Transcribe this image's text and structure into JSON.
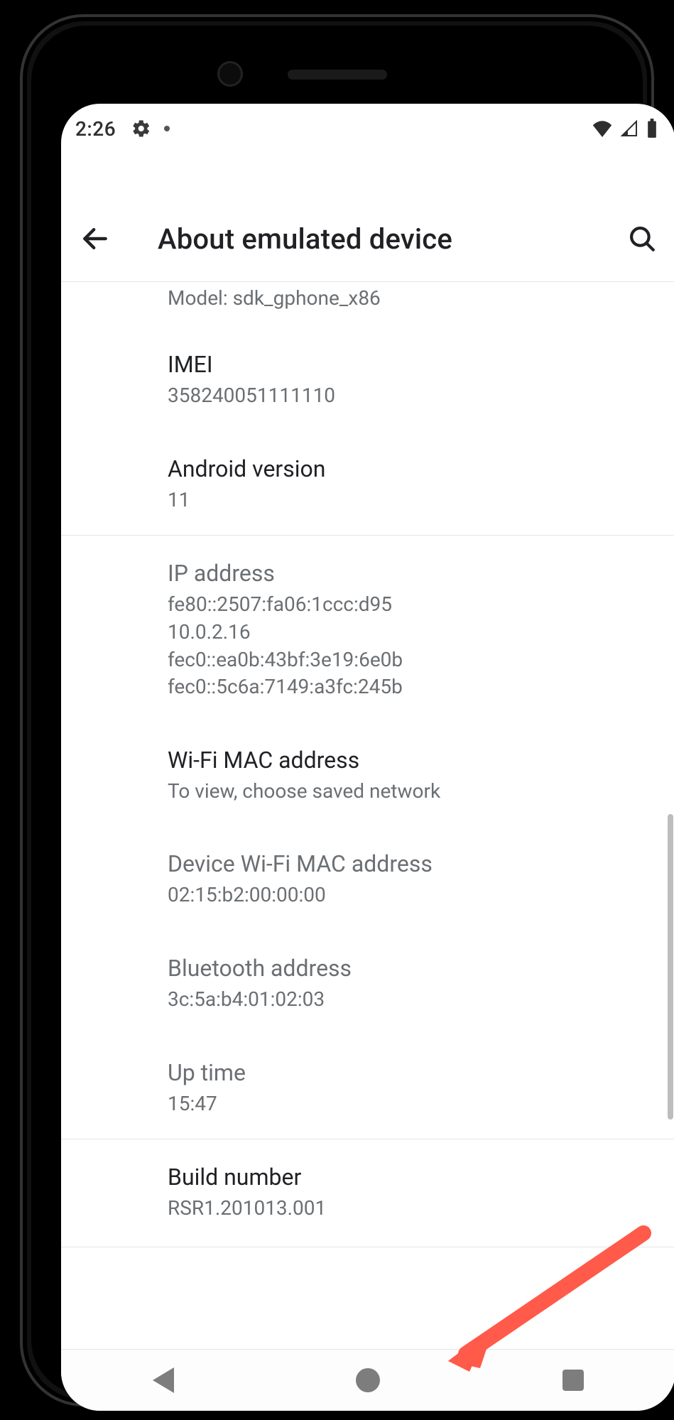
{
  "statusbar": {
    "time": "2:26"
  },
  "header": {
    "title": "About emulated device"
  },
  "model_line": "Model: sdk_gphone_x86",
  "items": {
    "imei": {
      "label": "IMEI",
      "value": "358240051111110"
    },
    "android": {
      "label": "Android version",
      "value": "11"
    },
    "ip": {
      "label": "IP address",
      "lines": [
        "fe80::2507:fa06:1ccc:d95",
        "10.0.2.16",
        "fec0::ea0b:43bf:3e19:6e0b",
        "fec0::5c6a:7149:a3fc:245b"
      ]
    },
    "wifimac": {
      "label": "Wi-Fi MAC address",
      "value": "To view, choose saved network"
    },
    "devwifimac": {
      "label": "Device Wi-Fi MAC address",
      "value": "02:15:b2:00:00:00"
    },
    "btaddr": {
      "label": "Bluetooth address",
      "value": "3c:5a:b4:01:02:03"
    },
    "uptime": {
      "label": "Up time",
      "value": "15:47"
    },
    "build": {
      "label": "Build number",
      "value": "RSR1.201013.001"
    }
  }
}
